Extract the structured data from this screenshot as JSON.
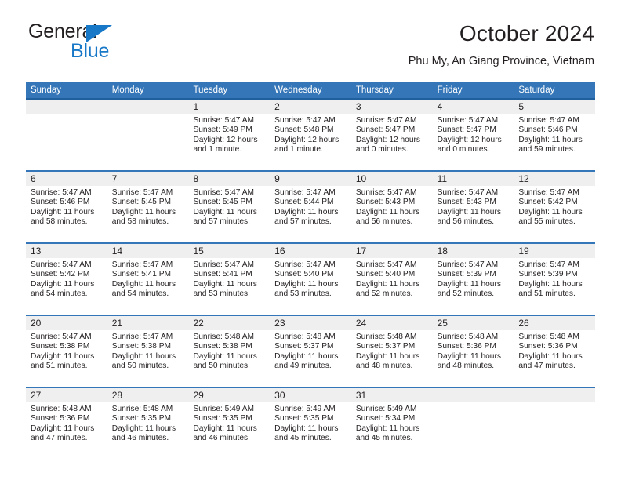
{
  "logo": {
    "word1": "General",
    "word2": "Blue",
    "accent_color": "#1878c8",
    "triangle_icon": "triangle-icon"
  },
  "header": {
    "title": "October 2024",
    "subtitle": "Phu My, An Giang Province, Vietnam"
  },
  "theme": {
    "header_blue": "#3576b8",
    "header_blue_dark": "#1f5f9e",
    "day_band_gray": "#efefef",
    "text": "#231f20"
  },
  "weekdays": [
    "Sunday",
    "Monday",
    "Tuesday",
    "Wednesday",
    "Thursday",
    "Friday",
    "Saturday"
  ],
  "weeks": [
    [
      {
        "day": "",
        "sunrise": "",
        "sunset": "",
        "daylight1": "",
        "daylight2": ""
      },
      {
        "day": "",
        "sunrise": "",
        "sunset": "",
        "daylight1": "",
        "daylight2": ""
      },
      {
        "day": "1",
        "sunrise": "Sunrise: 5:47 AM",
        "sunset": "Sunset: 5:49 PM",
        "daylight1": "Daylight: 12 hours",
        "daylight2": "and 1 minute."
      },
      {
        "day": "2",
        "sunrise": "Sunrise: 5:47 AM",
        "sunset": "Sunset: 5:48 PM",
        "daylight1": "Daylight: 12 hours",
        "daylight2": "and 1 minute."
      },
      {
        "day": "3",
        "sunrise": "Sunrise: 5:47 AM",
        "sunset": "Sunset: 5:47 PM",
        "daylight1": "Daylight: 12 hours",
        "daylight2": "and 0 minutes."
      },
      {
        "day": "4",
        "sunrise": "Sunrise: 5:47 AM",
        "sunset": "Sunset: 5:47 PM",
        "daylight1": "Daylight: 12 hours",
        "daylight2": "and 0 minutes."
      },
      {
        "day": "5",
        "sunrise": "Sunrise: 5:47 AM",
        "sunset": "Sunset: 5:46 PM",
        "daylight1": "Daylight: 11 hours",
        "daylight2": "and 59 minutes."
      }
    ],
    [
      {
        "day": "6",
        "sunrise": "Sunrise: 5:47 AM",
        "sunset": "Sunset: 5:46 PM",
        "daylight1": "Daylight: 11 hours",
        "daylight2": "and 58 minutes."
      },
      {
        "day": "7",
        "sunrise": "Sunrise: 5:47 AM",
        "sunset": "Sunset: 5:45 PM",
        "daylight1": "Daylight: 11 hours",
        "daylight2": "and 58 minutes."
      },
      {
        "day": "8",
        "sunrise": "Sunrise: 5:47 AM",
        "sunset": "Sunset: 5:45 PM",
        "daylight1": "Daylight: 11 hours",
        "daylight2": "and 57 minutes."
      },
      {
        "day": "9",
        "sunrise": "Sunrise: 5:47 AM",
        "sunset": "Sunset: 5:44 PM",
        "daylight1": "Daylight: 11 hours",
        "daylight2": "and 57 minutes."
      },
      {
        "day": "10",
        "sunrise": "Sunrise: 5:47 AM",
        "sunset": "Sunset: 5:43 PM",
        "daylight1": "Daylight: 11 hours",
        "daylight2": "and 56 minutes."
      },
      {
        "day": "11",
        "sunrise": "Sunrise: 5:47 AM",
        "sunset": "Sunset: 5:43 PM",
        "daylight1": "Daylight: 11 hours",
        "daylight2": "and 56 minutes."
      },
      {
        "day": "12",
        "sunrise": "Sunrise: 5:47 AM",
        "sunset": "Sunset: 5:42 PM",
        "daylight1": "Daylight: 11 hours",
        "daylight2": "and 55 minutes."
      }
    ],
    [
      {
        "day": "13",
        "sunrise": "Sunrise: 5:47 AM",
        "sunset": "Sunset: 5:42 PM",
        "daylight1": "Daylight: 11 hours",
        "daylight2": "and 54 minutes."
      },
      {
        "day": "14",
        "sunrise": "Sunrise: 5:47 AM",
        "sunset": "Sunset: 5:41 PM",
        "daylight1": "Daylight: 11 hours",
        "daylight2": "and 54 minutes."
      },
      {
        "day": "15",
        "sunrise": "Sunrise: 5:47 AM",
        "sunset": "Sunset: 5:41 PM",
        "daylight1": "Daylight: 11 hours",
        "daylight2": "and 53 minutes."
      },
      {
        "day": "16",
        "sunrise": "Sunrise: 5:47 AM",
        "sunset": "Sunset: 5:40 PM",
        "daylight1": "Daylight: 11 hours",
        "daylight2": "and 53 minutes."
      },
      {
        "day": "17",
        "sunrise": "Sunrise: 5:47 AM",
        "sunset": "Sunset: 5:40 PM",
        "daylight1": "Daylight: 11 hours",
        "daylight2": "and 52 minutes."
      },
      {
        "day": "18",
        "sunrise": "Sunrise: 5:47 AM",
        "sunset": "Sunset: 5:39 PM",
        "daylight1": "Daylight: 11 hours",
        "daylight2": "and 52 minutes."
      },
      {
        "day": "19",
        "sunrise": "Sunrise: 5:47 AM",
        "sunset": "Sunset: 5:39 PM",
        "daylight1": "Daylight: 11 hours",
        "daylight2": "and 51 minutes."
      }
    ],
    [
      {
        "day": "20",
        "sunrise": "Sunrise: 5:47 AM",
        "sunset": "Sunset: 5:38 PM",
        "daylight1": "Daylight: 11 hours",
        "daylight2": "and 51 minutes."
      },
      {
        "day": "21",
        "sunrise": "Sunrise: 5:47 AM",
        "sunset": "Sunset: 5:38 PM",
        "daylight1": "Daylight: 11 hours",
        "daylight2": "and 50 minutes."
      },
      {
        "day": "22",
        "sunrise": "Sunrise: 5:48 AM",
        "sunset": "Sunset: 5:38 PM",
        "daylight1": "Daylight: 11 hours",
        "daylight2": "and 50 minutes."
      },
      {
        "day": "23",
        "sunrise": "Sunrise: 5:48 AM",
        "sunset": "Sunset: 5:37 PM",
        "daylight1": "Daylight: 11 hours",
        "daylight2": "and 49 minutes."
      },
      {
        "day": "24",
        "sunrise": "Sunrise: 5:48 AM",
        "sunset": "Sunset: 5:37 PM",
        "daylight1": "Daylight: 11 hours",
        "daylight2": "and 48 minutes."
      },
      {
        "day": "25",
        "sunrise": "Sunrise: 5:48 AM",
        "sunset": "Sunset: 5:36 PM",
        "daylight1": "Daylight: 11 hours",
        "daylight2": "and 48 minutes."
      },
      {
        "day": "26",
        "sunrise": "Sunrise: 5:48 AM",
        "sunset": "Sunset: 5:36 PM",
        "daylight1": "Daylight: 11 hours",
        "daylight2": "and 47 minutes."
      }
    ],
    [
      {
        "day": "27",
        "sunrise": "Sunrise: 5:48 AM",
        "sunset": "Sunset: 5:36 PM",
        "daylight1": "Daylight: 11 hours",
        "daylight2": "and 47 minutes."
      },
      {
        "day": "28",
        "sunrise": "Sunrise: 5:48 AM",
        "sunset": "Sunset: 5:35 PM",
        "daylight1": "Daylight: 11 hours",
        "daylight2": "and 46 minutes."
      },
      {
        "day": "29",
        "sunrise": "Sunrise: 5:49 AM",
        "sunset": "Sunset: 5:35 PM",
        "daylight1": "Daylight: 11 hours",
        "daylight2": "and 46 minutes."
      },
      {
        "day": "30",
        "sunrise": "Sunrise: 5:49 AM",
        "sunset": "Sunset: 5:35 PM",
        "daylight1": "Daylight: 11 hours",
        "daylight2": "and 45 minutes."
      },
      {
        "day": "31",
        "sunrise": "Sunrise: 5:49 AM",
        "sunset": "Sunset: 5:34 PM",
        "daylight1": "Daylight: 11 hours",
        "daylight2": "and 45 minutes."
      },
      {
        "day": "",
        "sunrise": "",
        "sunset": "",
        "daylight1": "",
        "daylight2": ""
      },
      {
        "day": "",
        "sunrise": "",
        "sunset": "",
        "daylight1": "",
        "daylight2": ""
      }
    ]
  ]
}
